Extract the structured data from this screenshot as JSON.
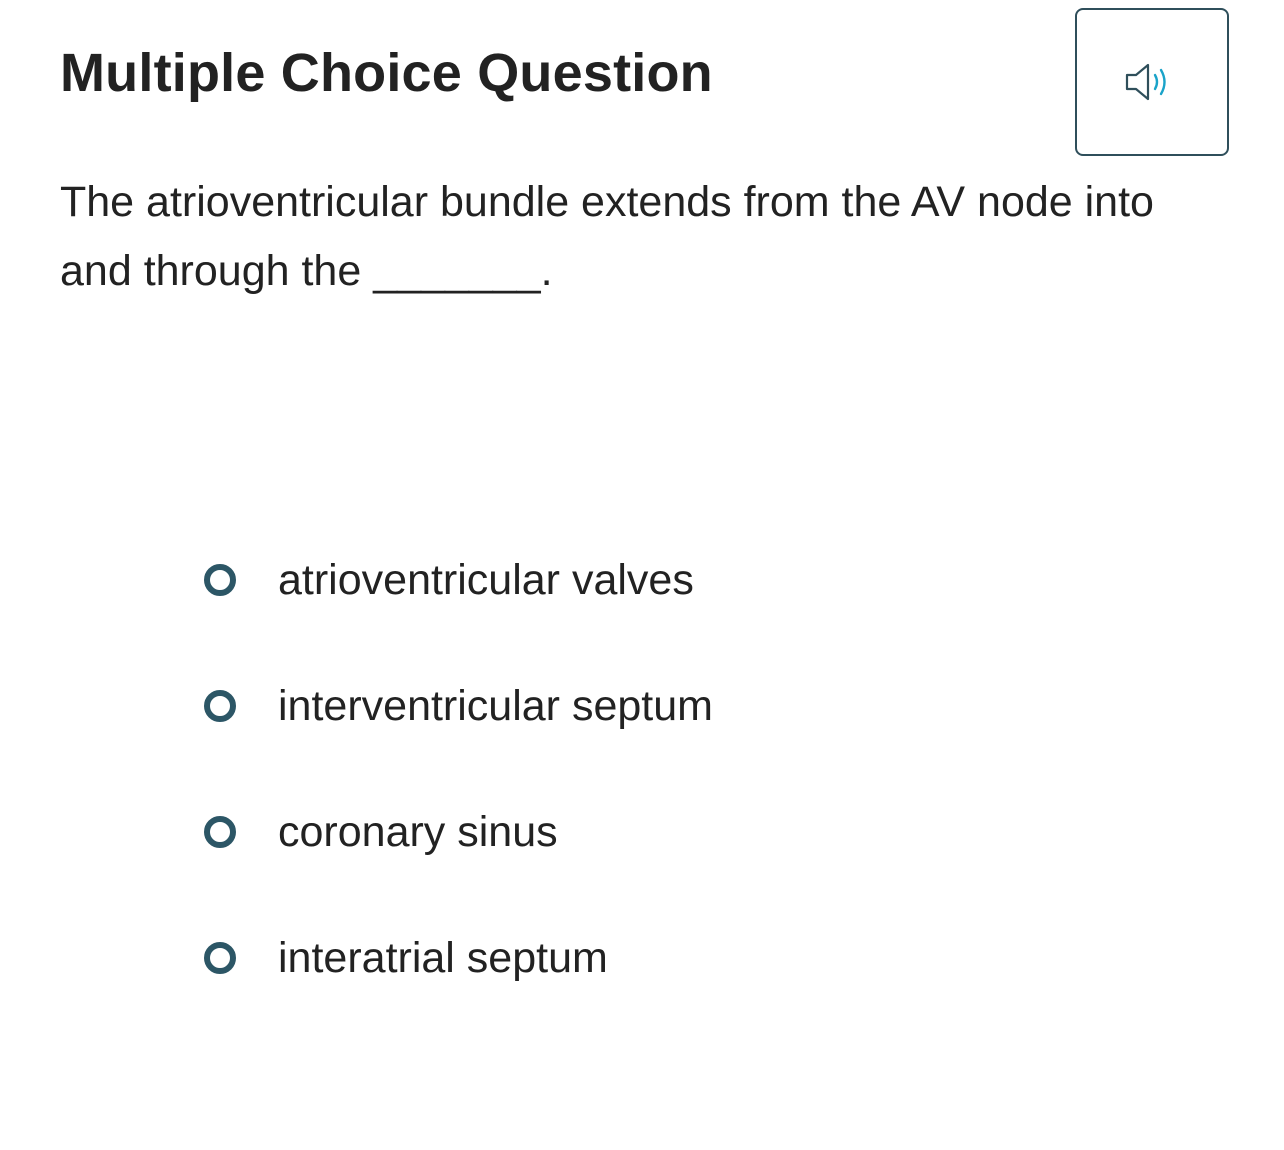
{
  "header": {
    "title": "Multiple Choice Question"
  },
  "audio_button": {
    "icon": "speaker-icon",
    "icon_color": "#2f4f5b",
    "wave_color": "#1aa3c9"
  },
  "question": {
    "text": "The atrioventricular bundle extends from the AV node into and through the _______."
  },
  "options": [
    {
      "label": "atrioventricular valves"
    },
    {
      "label": "interventricular septum"
    },
    {
      "label": "coronary sinus"
    },
    {
      "label": "interatrial septum"
    }
  ],
  "colors": {
    "radio_border": "#2c5666",
    "text": "#222222",
    "button_border": "#2f4f5b"
  }
}
